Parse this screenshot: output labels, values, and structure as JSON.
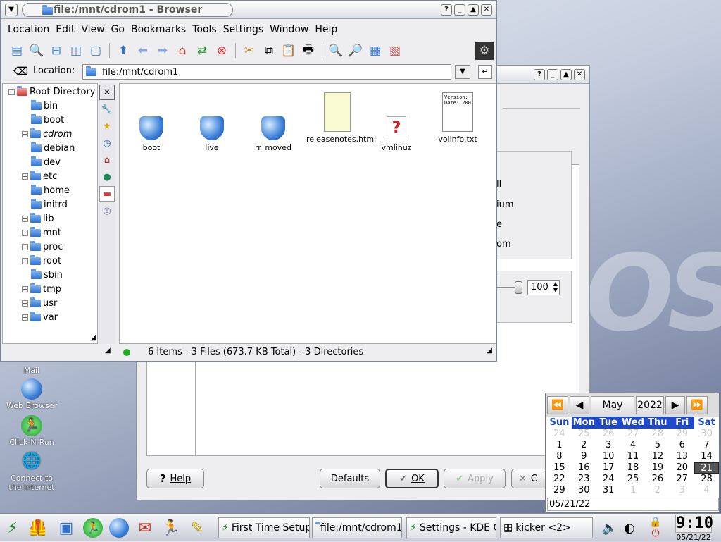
{
  "colors": {
    "accent": "#1f49c9",
    "folder": "#3b7fd8",
    "statusLed": "#22aa22"
  },
  "settings_dialog": {
    "partial_options": [
      "ll",
      "ium",
      "e",
      "om"
    ],
    "spin_value": "100",
    "buttons": {
      "help": "Help",
      "defaults": "Defaults",
      "ok": "OK",
      "apply": "Apply",
      "cancel": "C"
    }
  },
  "browser": {
    "title": "file:/mnt/cdrom1 - Browser",
    "menu": [
      "Location",
      "Edit",
      "View",
      "Go",
      "Bookmarks",
      "Tools",
      "Settings",
      "Window",
      "Help"
    ],
    "location_label": "Location:",
    "location_value": "file:/mnt/cdrom1",
    "tree": [
      {
        "label": "Root Directory",
        "expanded": true
      },
      {
        "label": "bin"
      },
      {
        "label": "boot"
      },
      {
        "label": "cdrom"
      },
      {
        "label": "debian"
      },
      {
        "label": "dev"
      },
      {
        "label": "etc"
      },
      {
        "label": "home"
      },
      {
        "label": "initrd"
      },
      {
        "label": "lib"
      },
      {
        "label": "mnt"
      },
      {
        "label": "proc"
      },
      {
        "label": "root"
      },
      {
        "label": "sbin"
      },
      {
        "label": "tmp"
      },
      {
        "label": "usr"
      },
      {
        "label": "var"
      }
    ],
    "files": [
      {
        "name": "boot",
        "type": "folder"
      },
      {
        "name": "live",
        "type": "folder"
      },
      {
        "name": "rr_moved",
        "type": "folder"
      },
      {
        "name": "releasenotes.html",
        "type": "html"
      },
      {
        "name": "vmlinuz",
        "type": "unknown"
      },
      {
        "name": "volinfo.txt",
        "type": "text",
        "preview": "Version:\nDate: 200"
      }
    ],
    "status": "6 Items - 3 Files (673.7 KB Total) - 3 Directories"
  },
  "calendar": {
    "month": "May",
    "year": "2022",
    "weekdays": [
      "Sun",
      "Mon",
      "Tue",
      "Wed",
      "Thu",
      "Fri",
      "Sat"
    ],
    "weeks": [
      [
        "24",
        "25",
        "26",
        "27",
        "28",
        "29",
        "30"
      ],
      [
        "1",
        "2",
        "3",
        "4",
        "5",
        "6",
        "7"
      ],
      [
        "8",
        "9",
        "10",
        "11",
        "12",
        "13",
        "14"
      ],
      [
        "15",
        "16",
        "17",
        "18",
        "19",
        "20",
        "21"
      ],
      [
        "22",
        "23",
        "24",
        "25",
        "26",
        "27",
        "28"
      ],
      [
        "29",
        "30",
        "31",
        "1",
        "2",
        "3",
        "4"
      ]
    ],
    "selected": "21",
    "date_field": "05/21/22"
  },
  "desktop": {
    "icons": [
      "Mail",
      "Web Browser",
      "Click-N-Run",
      "Connect to the Internet"
    ]
  },
  "taskbar": {
    "tasks": [
      "First Time Setup",
      "file:/mnt/cdrom1",
      "Settings - KDE C",
      "kicker <2>"
    ],
    "clock_time": "9:10",
    "clock_date": "05/21/22"
  }
}
